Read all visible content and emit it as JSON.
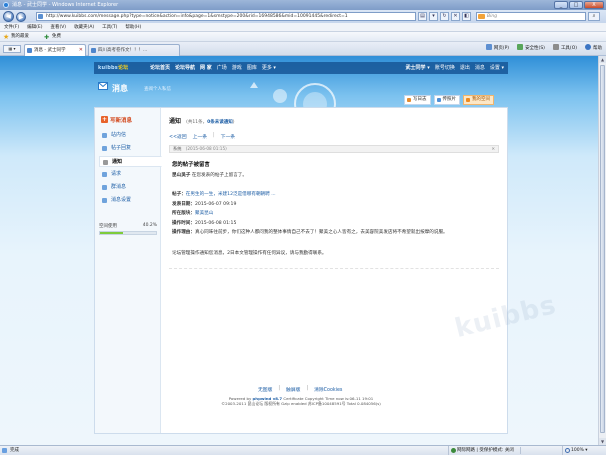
{
  "window": {
    "title": "消息 - 武士同学 - Windows Internet Explorer",
    "controls": [
      "_",
      "□",
      "X"
    ]
  },
  "address": {
    "url": "http://www.kuibbs.com/message.php?type=notice&action=info&page=1&smstype=200&rid=16948586&mid=10091445&redirect=1"
  },
  "search": {
    "placeholder": "Bing"
  },
  "menu": [
    "文件(F)",
    "编辑(E)",
    "查看(V)",
    "收藏夹(A)",
    "工具(T)",
    "帮助(H)"
  ],
  "favorites": {
    "label": "我的最爱",
    "link": "免费"
  },
  "tabs": [
    {
      "label": "消息 - 武士同学",
      "active": true
    },
    {
      "label": "四川高考卷作文！！！...",
      "active": false
    }
  ],
  "command_bar": [
    "网页(P)",
    "安全性(S)",
    "工具(O)",
    "帮助"
  ],
  "site": {
    "logo_prefix": "kuibbs",
    "logo_suffix": "论坛",
    "nav": [
      "论坛首页",
      "论坛导航",
      "网 家",
      "广场",
      "游戏",
      "图库",
      "更多"
    ],
    "user": [
      "武士同学",
      "账号切换",
      "退出",
      "消息",
      "设置"
    ]
  },
  "banner": {
    "title": "消息",
    "subtitle": "查阅个人私信"
  },
  "user_buttons": [
    "写日志",
    "传照片",
    "我的空间"
  ],
  "sidebar": {
    "compose": "写新消息",
    "items": [
      {
        "label": "站内信",
        "active": false
      },
      {
        "label": "帖子回复",
        "active": false
      },
      {
        "label": "通知",
        "active": true
      },
      {
        "label": "请求",
        "active": false
      },
      {
        "label": "群消息",
        "active": false
      },
      {
        "label": "消息设置",
        "active": false
      }
    ],
    "space_label": "空间使用",
    "space_percent": "40.2%",
    "space_fraction": 0.402
  },
  "main": {
    "title": "通知",
    "count": "(共11条，",
    "unread": "0条未读通知",
    "count_end": ")",
    "pager": {
      "back": "<<返回",
      "prev": "上一条",
      "next": "下一条"
    },
    "system_label": "系统",
    "system_time": "(2015-06-08 01:15)",
    "subject": "您的帖子被留言",
    "summary_user": "昆山吳子",
    "summary_text": "在您发表的帖子上留言了。",
    "post_label": "帖子：",
    "post_title": "在男生的一生，米建12泛是借哪有朝朝聘 ...",
    "date_label": "发表日期：",
    "date_value": "2015-06-07 09:19",
    "board_label": "所在版块：",
    "board_value": "聚美昆山",
    "op_time_label": "操作时间：",
    "op_time_value": "2015-06-08 01:15",
    "reason_label": "操作理由：",
    "reason_value": "真心同味往前步，你们这种人都问我的整体事情自己不去了！聚美之心人皆有之，去美容院美发店将不希望就出按摩的说服。",
    "note": "论坛管理操作通知您消息，2日本文管理操作有任何异议，请与我勤得联系。",
    "watermark": "kuibbs"
  },
  "footer": {
    "links": [
      "无图版",
      "触屏版",
      "清除Cookies"
    ],
    "powered_prefix": "Powered by ",
    "powered_brand": "phpwind v8.7",
    "powered_suffix": " Certificate Copyright Time now is:06-11 19:01",
    "copyright": "©2003-2011 昆山论坛 版权所有 Gzip enabled 苏ICP备10048591号 Total 0.084056(s)"
  },
  "status": {
    "left": "完成",
    "zone": "网际网路 | 受保护模式: 关闭",
    "zoom": "100%"
  }
}
